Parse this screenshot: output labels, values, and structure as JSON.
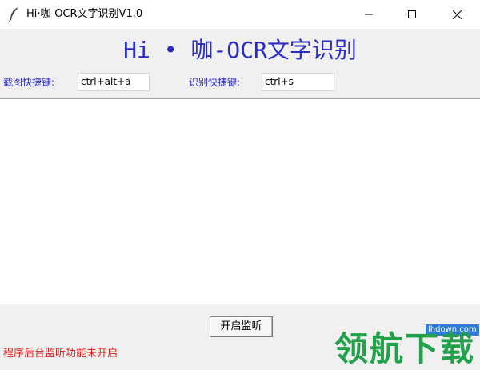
{
  "window": {
    "title": "Hi·咖-OCR文字识别V1.0",
    "icon": "feather-icon",
    "controls": [
      "minimize-icon",
      "maximize-icon",
      "close-icon"
    ]
  },
  "header": {
    "heading": "Hi • 咖-OCR文字识别"
  },
  "shortcuts": {
    "screenshot_label": "截图快捷键:",
    "screenshot_value": "ctrl+alt+a",
    "recognize_label": "识别快捷键:",
    "recognize_value": "ctrl+s"
  },
  "result": {
    "text": ""
  },
  "controls": {
    "start_button_label": "开启监听"
  },
  "status": {
    "text": "程序后台监听功能未开启"
  },
  "watermark": {
    "site": "lhdown.com",
    "brand": "领航下载"
  },
  "colors": {
    "heading": "#2b2bc8",
    "status": "#e01b1b",
    "watermark_brand": "#22a04a",
    "watermark_site_bg": "#2d7bd6"
  }
}
